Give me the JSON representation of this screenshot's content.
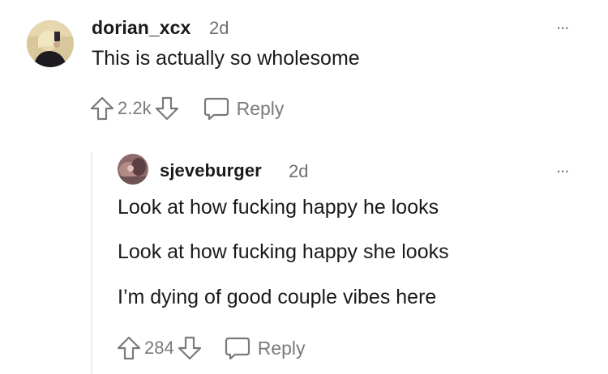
{
  "comment": {
    "username": "dorian_xcx",
    "timestamp": "2d",
    "text": "This is actually so wholesome",
    "score": "2.2k",
    "reply_label": "Reply",
    "more_label": "..."
  },
  "reply": {
    "username": "sjeveburger",
    "timestamp": "2d",
    "lines": [
      "Look at how fucking happy he looks",
      "Look at how fucking happy she looks",
      "I’m dying of good couple vibes here"
    ],
    "score": "284",
    "reply_label": "Reply",
    "more_label": "..."
  }
}
